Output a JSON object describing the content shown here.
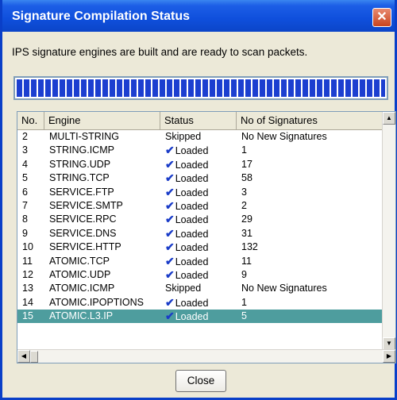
{
  "window": {
    "title": "Signature Compilation Status",
    "close_glyph": "✕"
  },
  "message": "IPS signature engines are built and are ready to scan packets.",
  "progress": {
    "fraction": 1.0,
    "color": "#1c3fd0"
  },
  "table": {
    "columns": [
      "No.",
      "Engine",
      "Status",
      "No of Signatures"
    ],
    "rows": [
      {
        "no": "2",
        "engine": "MULTI-STRING",
        "status": "Skipped",
        "checked": false,
        "sigs": "No New Signatures"
      },
      {
        "no": "3",
        "engine": "STRING.ICMP",
        "status": "Loaded",
        "checked": true,
        "sigs": "1"
      },
      {
        "no": "4",
        "engine": "STRING.UDP",
        "status": "Loaded",
        "checked": true,
        "sigs": "17"
      },
      {
        "no": "5",
        "engine": "STRING.TCP",
        "status": "Loaded",
        "checked": true,
        "sigs": "58"
      },
      {
        "no": "6",
        "engine": "SERVICE.FTP",
        "status": "Loaded",
        "checked": true,
        "sigs": "3"
      },
      {
        "no": "7",
        "engine": "SERVICE.SMTP",
        "status": "Loaded",
        "checked": true,
        "sigs": "2"
      },
      {
        "no": "8",
        "engine": "SERVICE.RPC",
        "status": "Loaded",
        "checked": true,
        "sigs": "29"
      },
      {
        "no": "9",
        "engine": "SERVICE.DNS",
        "status": "Loaded",
        "checked": true,
        "sigs": "31"
      },
      {
        "no": "10",
        "engine": "SERVICE.HTTP",
        "status": "Loaded",
        "checked": true,
        "sigs": "132"
      },
      {
        "no": "11",
        "engine": "ATOMIC.TCP",
        "status": "Loaded",
        "checked": true,
        "sigs": "11"
      },
      {
        "no": "12",
        "engine": "ATOMIC.UDP",
        "status": "Loaded",
        "checked": true,
        "sigs": "9"
      },
      {
        "no": "13",
        "engine": "ATOMIC.ICMP",
        "status": "Skipped",
        "checked": false,
        "sigs": "No New Signatures"
      },
      {
        "no": "14",
        "engine": "ATOMIC.IPOPTIONS",
        "status": "Loaded",
        "checked": true,
        "sigs": "1"
      },
      {
        "no": "15",
        "engine": "ATOMIC.L3.IP",
        "status": "Loaded",
        "checked": true,
        "sigs": "5",
        "selected": true
      }
    ],
    "selected_color": "#4e9d9e"
  },
  "buttons": {
    "close": "Close"
  }
}
